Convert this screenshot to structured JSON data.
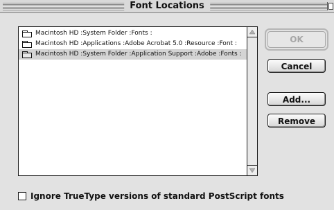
{
  "window": {
    "title": "Font Locations"
  },
  "list": {
    "items": [
      {
        "label": "Macintosh HD :System Folder :Fonts :",
        "selected": false
      },
      {
        "label": "Macintosh HD :Applications :Adobe Acrobat 5.0 :Resource :Font :",
        "selected": false
      },
      {
        "label": "Macintosh HD :System Folder :Application Support :Adobe :Fonts :",
        "selected": true
      }
    ]
  },
  "buttons": {
    "ok": "OK",
    "cancel": "Cancel",
    "add": "Add...",
    "remove": "Remove"
  },
  "option": {
    "label": "Ignore TrueType versions of standard PostScript fonts",
    "checked": false
  },
  "colors": {
    "selection": "#d4d4d4",
    "disabled_text": "#a6a6a6"
  },
  "icons": [
    "folder-icon",
    "scroll-up-arrow-icon",
    "scroll-down-arrow-icon",
    "zoom-box-icon"
  ]
}
